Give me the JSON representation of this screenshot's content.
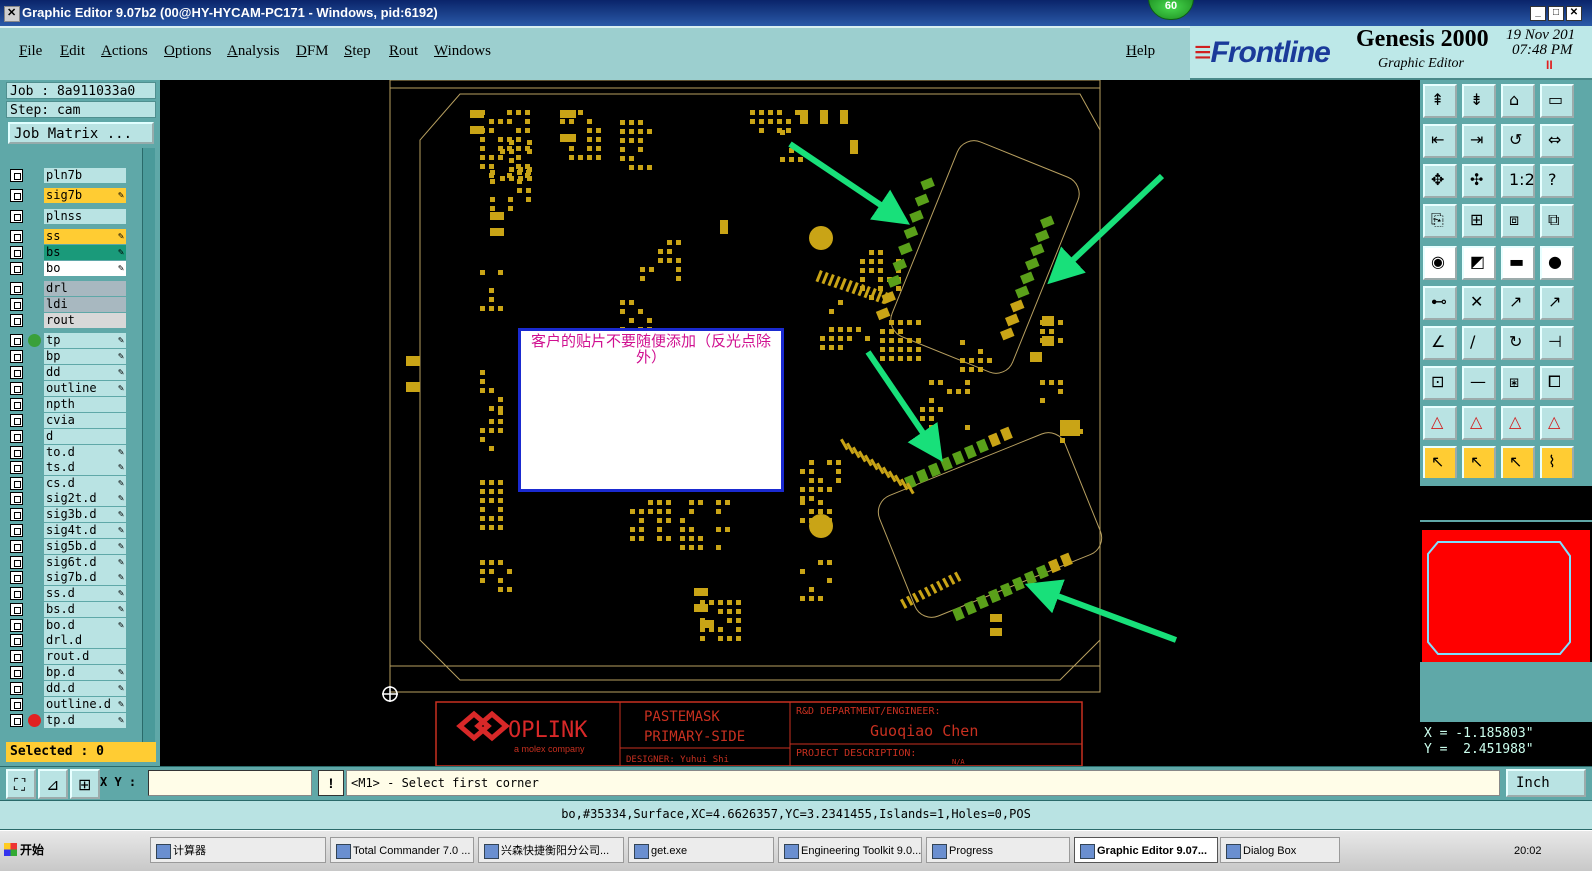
{
  "window": {
    "title": "Graphic Editor 9.07b2 (00@HY-HYCAM-PC171 - Windows, pid:6192)",
    "badge": "60",
    "min": "_",
    "max": "□",
    "close": "✕"
  },
  "menu": [
    "File",
    "Edit",
    "Actions",
    "Options",
    "Analysis",
    "DFM",
    "Step",
    "Rout",
    "Windows"
  ],
  "help": "Help",
  "brand": {
    "logo": "Frontline",
    "product": "Genesis 2000",
    "subtitle": "Graphic Editor",
    "date": "19 Nov 201",
    "time": "07:48 PM",
    "pause": "II"
  },
  "job": {
    "job": "Job : 8a911033a0",
    "step": "Step: cam",
    "matrix": "Job Matrix ..."
  },
  "layers": [
    {
      "name": "pln7b",
      "color": "#b9e3e3"
    },
    {
      "name": "sig7b",
      "color": "#ffcc33",
      "pen": true
    },
    {
      "name": "plnss",
      "color": "#b9e3e3"
    },
    {
      "name": "ss",
      "color": "#ffcc33",
      "pen": true
    },
    {
      "name": "bs",
      "color": "#1a9a7a",
      "pen": true
    },
    {
      "name": "bo",
      "color": "#ffffff",
      "pen": true
    },
    {
      "name": "drl",
      "color": "#a8b8c0"
    },
    {
      "name": "ldi",
      "color": "#a8b8c0"
    },
    {
      "name": "rout",
      "color": "#d8d8d8"
    },
    {
      "name": "tp",
      "color": "#b9e3e3",
      "pen": true,
      "dot": "#3aa03a"
    },
    {
      "name": "bp",
      "color": "#b9e3e3",
      "pen": true
    },
    {
      "name": "dd",
      "color": "#b9e3e3",
      "pen": true
    },
    {
      "name": "outline",
      "color": "#b9e3e3",
      "pen": true
    },
    {
      "name": "npth",
      "color": "#b9e3e3"
    },
    {
      "name": "cvia",
      "color": "#b9e3e3"
    },
    {
      "name": "d",
      "color": "#b9e3e3"
    },
    {
      "name": "to.d",
      "color": "#b9e3e3",
      "pen": true
    },
    {
      "name": "ts.d",
      "color": "#b9e3e3",
      "pen": true
    },
    {
      "name": "cs.d",
      "color": "#b9e3e3",
      "pen": true
    },
    {
      "name": "sig2t.d",
      "color": "#b9e3e3",
      "pen": true
    },
    {
      "name": "sig3b.d",
      "color": "#b9e3e3",
      "pen": true
    },
    {
      "name": "sig4t.d",
      "color": "#b9e3e3",
      "pen": true
    },
    {
      "name": "sig5b.d",
      "color": "#b9e3e3",
      "pen": true
    },
    {
      "name": "sig6t.d",
      "color": "#b9e3e3",
      "pen": true
    },
    {
      "name": "sig7b.d",
      "color": "#b9e3e3",
      "pen": true
    },
    {
      "name": "ss.d",
      "color": "#b9e3e3",
      "pen": true
    },
    {
      "name": "bs.d",
      "color": "#b9e3e3",
      "pen": true
    },
    {
      "name": "bo.d",
      "color": "#b9e3e3",
      "pen": true
    },
    {
      "name": "drl.d",
      "color": "#b9e3e3"
    },
    {
      "name": "rout.d",
      "color": "#b9e3e3"
    },
    {
      "name": "bp.d",
      "color": "#b9e3e3",
      "pen": true
    },
    {
      "name": "dd.d",
      "color": "#b9e3e3",
      "pen": true
    },
    {
      "name": "outline.d",
      "color": "#b9e3e3",
      "pen": true
    },
    {
      "name": "tp.d",
      "color": "#b9e3e3",
      "pen": true,
      "dot": "#e02020"
    }
  ],
  "selected": "Selected : 0",
  "note": "客户的贴片不要随便添加（反光点除外）",
  "titleblock": {
    "company": "OPLINK",
    "tagline": "a molex company",
    "layer1": "PASTEMASK",
    "layer2": "PRIMARY-SIDE",
    "designer": "DESIGNER: Yuhui Shi",
    "dept": "R&D DEPARTMENT/ENGINEER:",
    "engineer": "Guoqiao Chen",
    "project": "PROJECT DESCRIPTION:",
    "proj_val": "N/A"
  },
  "coords": {
    "x": "X = -1.185803\"",
    "y": "Y =  2.451988\""
  },
  "bottom": {
    "xy_label": "X Y :",
    "xy_value": "",
    "bang": "!",
    "prompt": "<M1> - Select first corner",
    "units": "Inch"
  },
  "status": "bo,#35334,Surface,XC=4.6626357,YC=3.2341455,Islands=1,Holes=0,POS",
  "taskbar": {
    "start": "开始",
    "tasks": [
      "计算器",
      "Total Commander 7.0 ...",
      "兴森快捷衡阳分公司...",
      "get.exe",
      "Engineering Toolkit 9.0...",
      "Progress",
      "Graphic Editor 9.07...",
      "Dialog Box"
    ],
    "active": "Graphic Editor 9.07...",
    "clock": "20:02"
  },
  "colors": {
    "accent_teal": "#9ccfcf",
    "pad": "#c9a416",
    "highlight_pad": "#5aa01a",
    "arrow": "#18e07a",
    "outline": "#b8a060"
  }
}
